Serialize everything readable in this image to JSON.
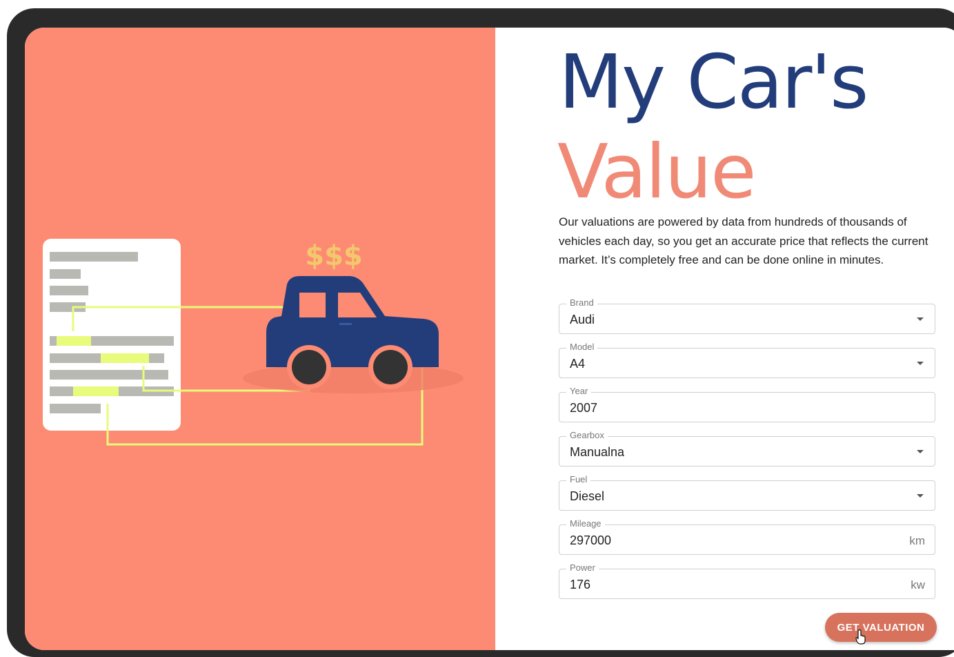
{
  "hero": {
    "title_line1": "My Car's",
    "title_line2": "Value",
    "description": "Our valuations are powered by data from hundreds of thousands of vehicles each day, so you get an accurate price that reflects the current market. It’s completely free and can be done online in minutes."
  },
  "illustration": {
    "price_symbol": "$$$"
  },
  "form": {
    "brand": {
      "label": "Brand",
      "value": "Audi"
    },
    "model": {
      "label": "Model",
      "value": "A4"
    },
    "year": {
      "label": "Year",
      "value": "2007"
    },
    "gearbox": {
      "label": "Gearbox",
      "value": "Manualna"
    },
    "fuel": {
      "label": "Fuel",
      "value": "Diesel"
    },
    "mileage": {
      "label": "Mileage",
      "value": "297000",
      "unit": "km"
    },
    "power": {
      "label": "Power",
      "value": "176",
      "unit": "kw"
    },
    "submit_label": "GET VALUATION"
  },
  "colors": {
    "accent": "#fd8b73",
    "title_primary": "#233d7b",
    "title_secondary": "#f08a76",
    "button": "#d7725d",
    "car": "#233d7b",
    "highlight": "#e8fb7a"
  },
  "icons": {
    "dropdown": "chevron-down-icon",
    "cursor": "hand-pointer-icon"
  }
}
